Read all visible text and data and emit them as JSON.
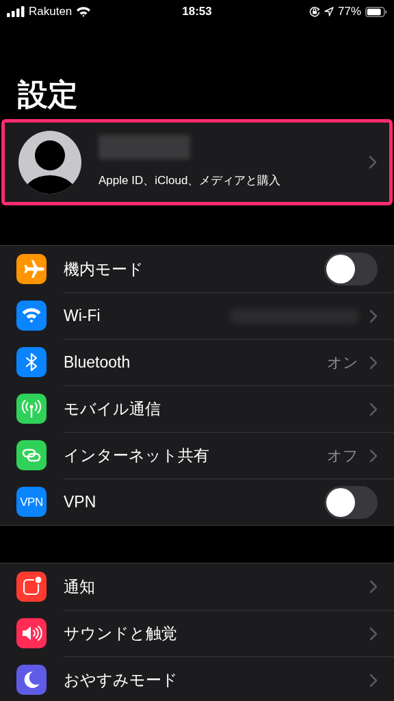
{
  "status_bar": {
    "carrier": "Rakuten",
    "time": "18:53",
    "battery": "77%"
  },
  "title": "設定",
  "profile": {
    "subtitle": "Apple ID、iCloud、メディアと購入",
    "highlighted": true
  },
  "sections": [
    {
      "rows": [
        {
          "kind": "toggle",
          "label": "機内モード",
          "color": "#ff9500",
          "on": false
        },
        {
          "kind": "link",
          "label": "Wi-Fi",
          "color": "#0a84ff",
          "value_blurred": true
        },
        {
          "kind": "link",
          "label": "Bluetooth",
          "color": "#0a84ff",
          "value": "オン"
        },
        {
          "kind": "link",
          "label": "モバイル通信",
          "color": "#30d158"
        },
        {
          "kind": "link",
          "label": "インターネット共有",
          "color": "#30d158",
          "value": "オフ"
        },
        {
          "kind": "toggle",
          "label": "VPN",
          "color": "#0a84ff",
          "icon_text": "VPN",
          "on": false
        }
      ]
    },
    {
      "rows": [
        {
          "kind": "link",
          "label": "通知",
          "color": "#ff3b30"
        },
        {
          "kind": "link",
          "label": "サウンドと触覚",
          "color": "#ff2d55"
        },
        {
          "kind": "link",
          "label": "おやすみモード",
          "color": "#5e5ce6"
        }
      ]
    }
  ]
}
